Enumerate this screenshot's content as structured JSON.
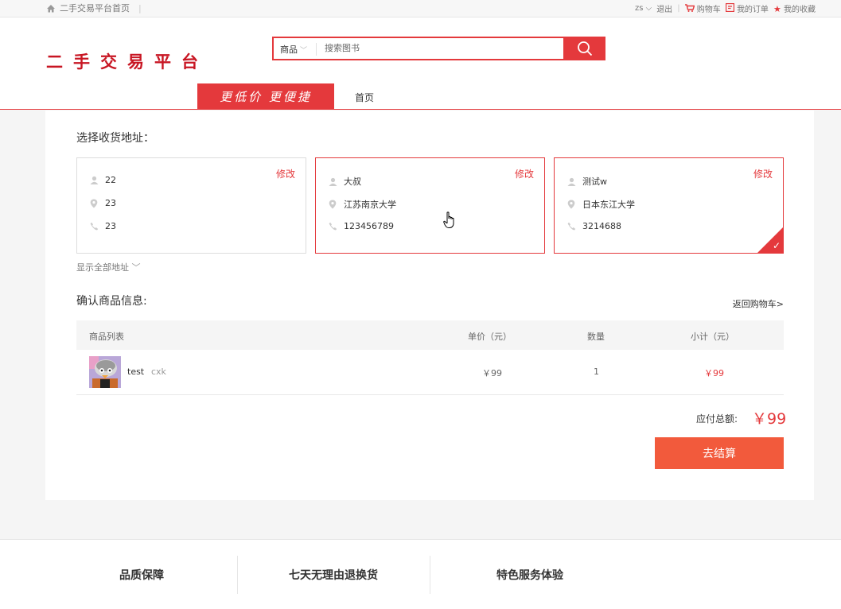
{
  "topbar": {
    "home_label": "二手交易平台首页",
    "user": "zs",
    "logout": "退出",
    "cart": "购物车",
    "orders": "我的订单",
    "favorites": "我的收藏"
  },
  "header": {
    "logo": "二手交易平台",
    "search_category": "商品",
    "search_placeholder": "搜索图书",
    "slogan": "更低价 更便捷",
    "nav_home": "首页"
  },
  "address": {
    "section_title": "选择收货地址：",
    "edit_label": "修改",
    "cards": [
      {
        "name": "22",
        "location": "23",
        "phone": "23",
        "state": "normal"
      },
      {
        "name": "大叔",
        "location": "江苏南京大学",
        "phone": "123456789",
        "state": "hover"
      },
      {
        "name": "测试w",
        "location": "日本东江大学",
        "phone": "3214688",
        "state": "selected"
      }
    ],
    "show_all": "显示全部地址"
  },
  "goods": {
    "section_title": "确认商品信息:",
    "back_to_cart": "返回购物车>",
    "columns": [
      "商品列表",
      "单价（元）",
      "数量",
      "小计（元）"
    ],
    "rows": [
      {
        "name": "test",
        "seller": "cxk",
        "price": "￥99",
        "qty": "1",
        "subtotal": "￥99"
      }
    ],
    "total_label": "应付总额:",
    "total_value": "￥99",
    "checkout": "去结算"
  },
  "footer": {
    "features": [
      "品质保障",
      "七天无理由退换货",
      "特色服务体验"
    ]
  },
  "colors": {
    "accent": "#e4393c",
    "checkout": "#f25a3c"
  }
}
